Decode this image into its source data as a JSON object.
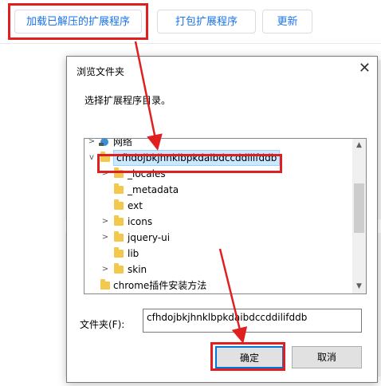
{
  "toolbar": {
    "load_unpacked": "加载已解压的扩展程序",
    "pack_extension": "打包扩展程序",
    "update": "更新"
  },
  "dialog": {
    "title": "浏览文件夹",
    "close_glyph": "✕",
    "description": "选择扩展程序目录。",
    "tree": {
      "network": "网络",
      "selected_folder": "cfhdojbkjhnklbpkdaibdccddilifddb",
      "children": [
        "_locales",
        "_metadata",
        "ext",
        "icons",
        "jquery-ui",
        "lib",
        "skin"
      ],
      "sibling": "chrome插件安装方法"
    },
    "folder_label": "文件夹(F):",
    "folder_value": "cfhdojbkjhnklbpkdaibdccddilifddb",
    "ok_label": "确定",
    "cancel_label": "取消"
  },
  "colors": {
    "accent": "#1a73e8",
    "highlight_red": "#e02020",
    "selection_bg": "#cce8ff",
    "folder_yellow": "#f2c94c"
  }
}
